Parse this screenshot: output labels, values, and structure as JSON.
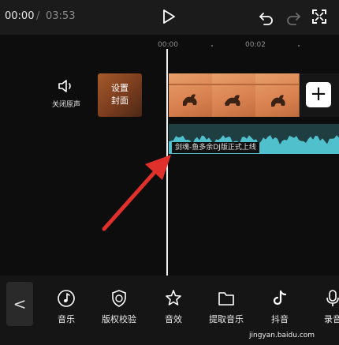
{
  "player": {
    "current_time": "00:00",
    "separator": "/",
    "total_time": "03:53",
    "icons": [
      "play-icon",
      "undo-icon",
      "redo-icon",
      "fullscreen-icon"
    ]
  },
  "timeline": {
    "ruler": [
      "00:00",
      "00:02"
    ],
    "mute_label": "关闭原声",
    "cover_label": "设置\n封面",
    "add_label": "+",
    "audio_clip_title": "剑魂-鱼多余DJ版正式上线",
    "colors": {
      "audio": "#4fc0cc",
      "video": "#d98a57",
      "arrow": "#e0302b"
    }
  },
  "toolbar": {
    "back_label": "<",
    "items": [
      {
        "label": "音乐",
        "icon": "music-icon"
      },
      {
        "label": "版权校验",
        "icon": "copyright-shield-icon"
      },
      {
        "label": "音效",
        "icon": "sound-effect-star-icon"
      },
      {
        "label": "提取音乐",
        "icon": "folder-icon"
      },
      {
        "label": "抖音",
        "icon": "tiktok-icon"
      },
      {
        "label": "录音",
        "icon": "microphone-icon"
      }
    ]
  },
  "watermark": {
    "text": "jingyan.baidu.com"
  }
}
